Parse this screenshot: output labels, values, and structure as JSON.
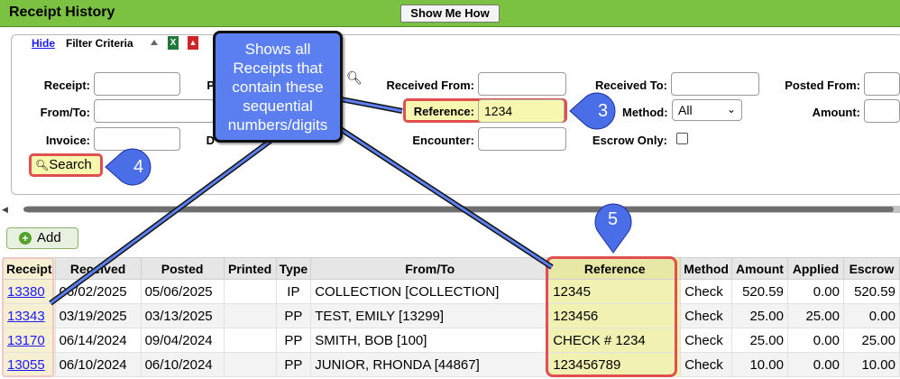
{
  "header": {
    "title": "Receipt History",
    "show_me_label": "Show Me How"
  },
  "filter": {
    "hide_link": "Hide",
    "title": "Filter Criteria",
    "receipt_label": "Receipt:",
    "from_to_label": "From/To:",
    "invoice_label": "Invoice:",
    "received_from_label": "Received From:",
    "reference_label": "Reference:",
    "reference_value": "1234",
    "encounter_label": "Encounter:",
    "received_to_label": "Received To:",
    "method_label": "Method:",
    "method_value": "All",
    "escrow_only_label": "Escrow Only:",
    "posted_from_label": "Posted From:",
    "amount_label": "Amount:",
    "search_label": "Search"
  },
  "annotations": {
    "callout_text": "Shows all Receipts that contain these sequential numbers/digits",
    "badge_3": "3",
    "badge_4": "4",
    "badge_5": "5"
  },
  "add_label": "Add",
  "table": {
    "headers": [
      "Receipt",
      "Received",
      "Posted",
      "Printed",
      "Type",
      "From/To",
      "Reference",
      "Method",
      "Amount",
      "Applied",
      "Escrow"
    ],
    "rows": [
      [
        "13380",
        "06/02/2025",
        "05/06/2025",
        "",
        "IP",
        "COLLECTION [COLLECTION]",
        "12345",
        "Check",
        "520.59",
        "0.00",
        "520.59"
      ],
      [
        "13343",
        "03/19/2025",
        "03/13/2025",
        "",
        "PP",
        "TEST, EMILY [13299]",
        "123456",
        "Check",
        "25.00",
        "25.00",
        "0.00"
      ],
      [
        "13170",
        "06/14/2024",
        "09/04/2024",
        "",
        "PP",
        "SMITH, BOB [100]",
        "CHECK # 1234",
        "Check",
        "25.00",
        "0.00",
        "25.00"
      ],
      [
        "13055",
        "06/10/2024",
        "06/10/2024",
        "",
        "PP",
        "JUNIOR, RHONDA [44867]",
        "123456789",
        "Check",
        "10.00",
        "0.00",
        "10.00"
      ]
    ]
  },
  "colors": {
    "header_green": "#7cc242",
    "callout_blue": "#5b7ff0",
    "highlight_yellow": "#f7f7b0",
    "outline_red": "#e05050"
  }
}
